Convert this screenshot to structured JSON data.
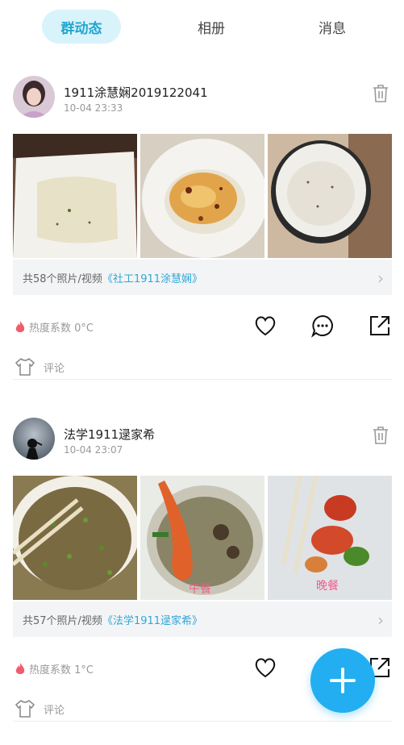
{
  "tabs": [
    {
      "label": "群动态",
      "active": true
    },
    {
      "label": "相册",
      "active": false
    },
    {
      "label": "消息",
      "active": false
    }
  ],
  "posts": [
    {
      "author": "1911涂慧娴2019122041",
      "time": "10-04 23:33",
      "album_prefix": "共58个照片/视频",
      "album_link": "《社工1911涂慧娴》",
      "heat": "热度系数 0°C",
      "comment_placeholder": "评论",
      "photo_labels": [
        "",
        "",
        ""
      ]
    },
    {
      "author": "法学1911逯家希",
      "time": "10-04 23:07",
      "album_prefix": "共57个照片/视频",
      "album_link": "《法学1911逯家希》",
      "heat": "热度系数 1°C",
      "comment_placeholder": "评论",
      "photo_labels": [
        "",
        "午餐",
        "晚餐"
      ]
    }
  ],
  "colors": {
    "accent": "#22a6cf",
    "fab": "#22aef0",
    "heat_icon": "#f05c6a"
  },
  "icons": [
    "trash-icon",
    "heart-icon",
    "comment-icon",
    "share-icon",
    "tshirt-icon",
    "flame-icon",
    "plus-icon",
    "chevron-right-icon"
  ]
}
